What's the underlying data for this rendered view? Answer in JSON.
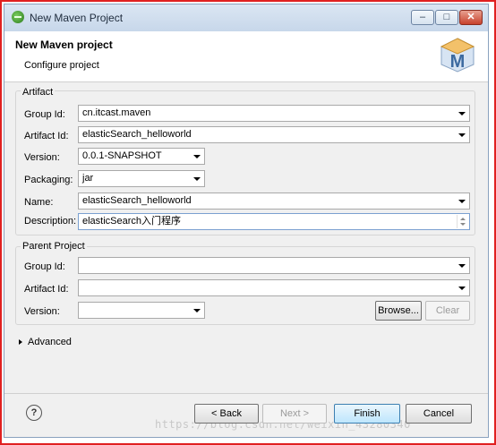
{
  "window": {
    "title": "New Maven Project"
  },
  "header": {
    "title": "New Maven project",
    "subtitle": "Configure project"
  },
  "artifact": {
    "legend": "Artifact",
    "group_id_label": "Group Id:",
    "group_id_value": "cn.itcast.maven",
    "artifact_id_label": "Artifact Id:",
    "artifact_id_value": "elasticSearch_helloworld",
    "version_label": "Version:",
    "version_value": "0.0.1-SNAPSHOT",
    "packaging_label": "Packaging:",
    "packaging_value": "jar",
    "name_label": "Name:",
    "name_value": "elasticSearch_helloworld",
    "description_label": "Description:",
    "description_value": "elasticSearch入门程序"
  },
  "parent": {
    "legend": "Parent Project",
    "group_id_label": "Group Id:",
    "group_id_value": "",
    "artifact_id_label": "Artifact Id:",
    "artifact_id_value": "",
    "version_label": "Version:",
    "version_value": "",
    "browse_label": "Browse...",
    "clear_label": "Clear"
  },
  "advanced_label": "Advanced",
  "buttons": {
    "back": "< Back",
    "next": "Next >",
    "finish": "Finish",
    "cancel": "Cancel"
  },
  "logo_letter": "M",
  "help_glyph": "?",
  "watermark": "https://blog.csdn.net/weixin_43280340",
  "colors": {
    "frame": "#e02020",
    "titlebar": "#c7d7ea",
    "close": "#c8422c"
  }
}
